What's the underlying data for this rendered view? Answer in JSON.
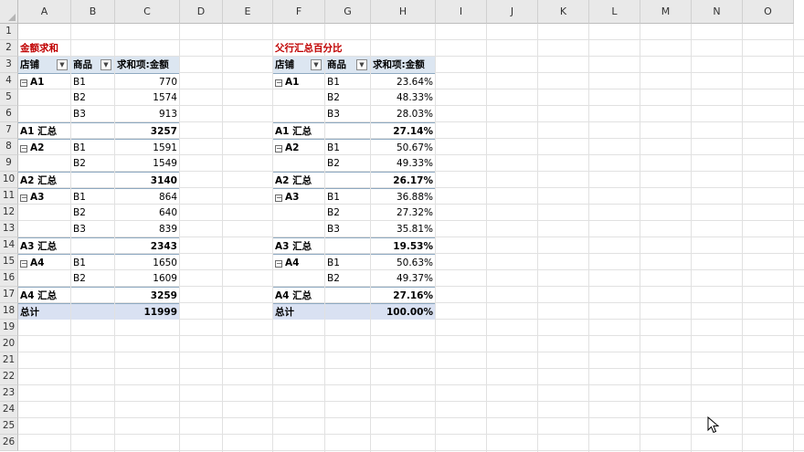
{
  "columns": [
    "A",
    "B",
    "C",
    "D",
    "E",
    "F",
    "G",
    "H",
    "I",
    "J",
    "K",
    "L",
    "M",
    "N",
    "O"
  ],
  "rows": [
    "1",
    "2",
    "3",
    "4",
    "5",
    "6",
    "7",
    "8",
    "9",
    "10",
    "11",
    "12",
    "13",
    "14",
    "15",
    "16",
    "17",
    "18",
    "19",
    "20",
    "21",
    "22",
    "23",
    "24",
    "25",
    "26"
  ],
  "pivot_left": {
    "title": "金额求和",
    "headers": [
      "店铺",
      "商品",
      "求和项:金额"
    ],
    "rows": [
      {
        "a": "A1",
        "b": "B1",
        "c": "770",
        "kind": "first"
      },
      {
        "a": "",
        "b": "B2",
        "c": "1574",
        "kind": "item"
      },
      {
        "a": "",
        "b": "B3",
        "c": "913",
        "kind": "item"
      },
      {
        "a": "A1 汇总",
        "b": "",
        "c": "3257",
        "kind": "subtotal"
      },
      {
        "a": "A2",
        "b": "B1",
        "c": "1591",
        "kind": "first"
      },
      {
        "a": "",
        "b": "B2",
        "c": "1549",
        "kind": "item"
      },
      {
        "a": "A2 汇总",
        "b": "",
        "c": "3140",
        "kind": "subtotal"
      },
      {
        "a": "A3",
        "b": "B1",
        "c": "864",
        "kind": "first"
      },
      {
        "a": "",
        "b": "B2",
        "c": "640",
        "kind": "item"
      },
      {
        "a": "",
        "b": "B3",
        "c": "839",
        "kind": "item"
      },
      {
        "a": "A3 汇总",
        "b": "",
        "c": "2343",
        "kind": "subtotal"
      },
      {
        "a": "A4",
        "b": "B1",
        "c": "1650",
        "kind": "first"
      },
      {
        "a": "",
        "b": "B2",
        "c": "1609",
        "kind": "item"
      },
      {
        "a": "A4 汇总",
        "b": "",
        "c": "3259",
        "kind": "subtotal"
      },
      {
        "a": "总计",
        "b": "",
        "c": "11999",
        "kind": "grand"
      }
    ]
  },
  "pivot_right": {
    "title": "父行汇总百分比",
    "headers": [
      "店铺",
      "商品",
      "求和项:金额"
    ],
    "rows": [
      {
        "a": "A1",
        "b": "B1",
        "c": "23.64%",
        "kind": "first"
      },
      {
        "a": "",
        "b": "B2",
        "c": "48.33%",
        "kind": "item"
      },
      {
        "a": "",
        "b": "B3",
        "c": "28.03%",
        "kind": "item"
      },
      {
        "a": "A1 汇总",
        "b": "",
        "c": "27.14%",
        "kind": "subtotal"
      },
      {
        "a": "A2",
        "b": "B1",
        "c": "50.67%",
        "kind": "first"
      },
      {
        "a": "",
        "b": "B2",
        "c": "49.33%",
        "kind": "item"
      },
      {
        "a": "A2 汇总",
        "b": "",
        "c": "26.17%",
        "kind": "subtotal"
      },
      {
        "a": "A3",
        "b": "B1",
        "c": "36.88%",
        "kind": "first"
      },
      {
        "a": "",
        "b": "B2",
        "c": "27.32%",
        "kind": "item"
      },
      {
        "a": "",
        "b": "B3",
        "c": "35.81%",
        "kind": "item"
      },
      {
        "a": "A3 汇总",
        "b": "",
        "c": "19.53%",
        "kind": "subtotal"
      },
      {
        "a": "A4",
        "b": "B1",
        "c": "50.63%",
        "kind": "first"
      },
      {
        "a": "",
        "b": "B2",
        "c": "49.37%",
        "kind": "item"
      },
      {
        "a": "A4 汇总",
        "b": "",
        "c": "27.16%",
        "kind": "subtotal"
      },
      {
        "a": "总计",
        "b": "",
        "c": "100.00%",
        "kind": "grand"
      }
    ]
  },
  "icons": {
    "collapse": "minus-box-icon",
    "filter": "filter-dropdown-icon",
    "cursor": "mouse-pointer-icon"
  },
  "colors": {
    "title": "#c00000",
    "header_fill": "#dce6f1",
    "total_fill": "#d9e1f2"
  }
}
